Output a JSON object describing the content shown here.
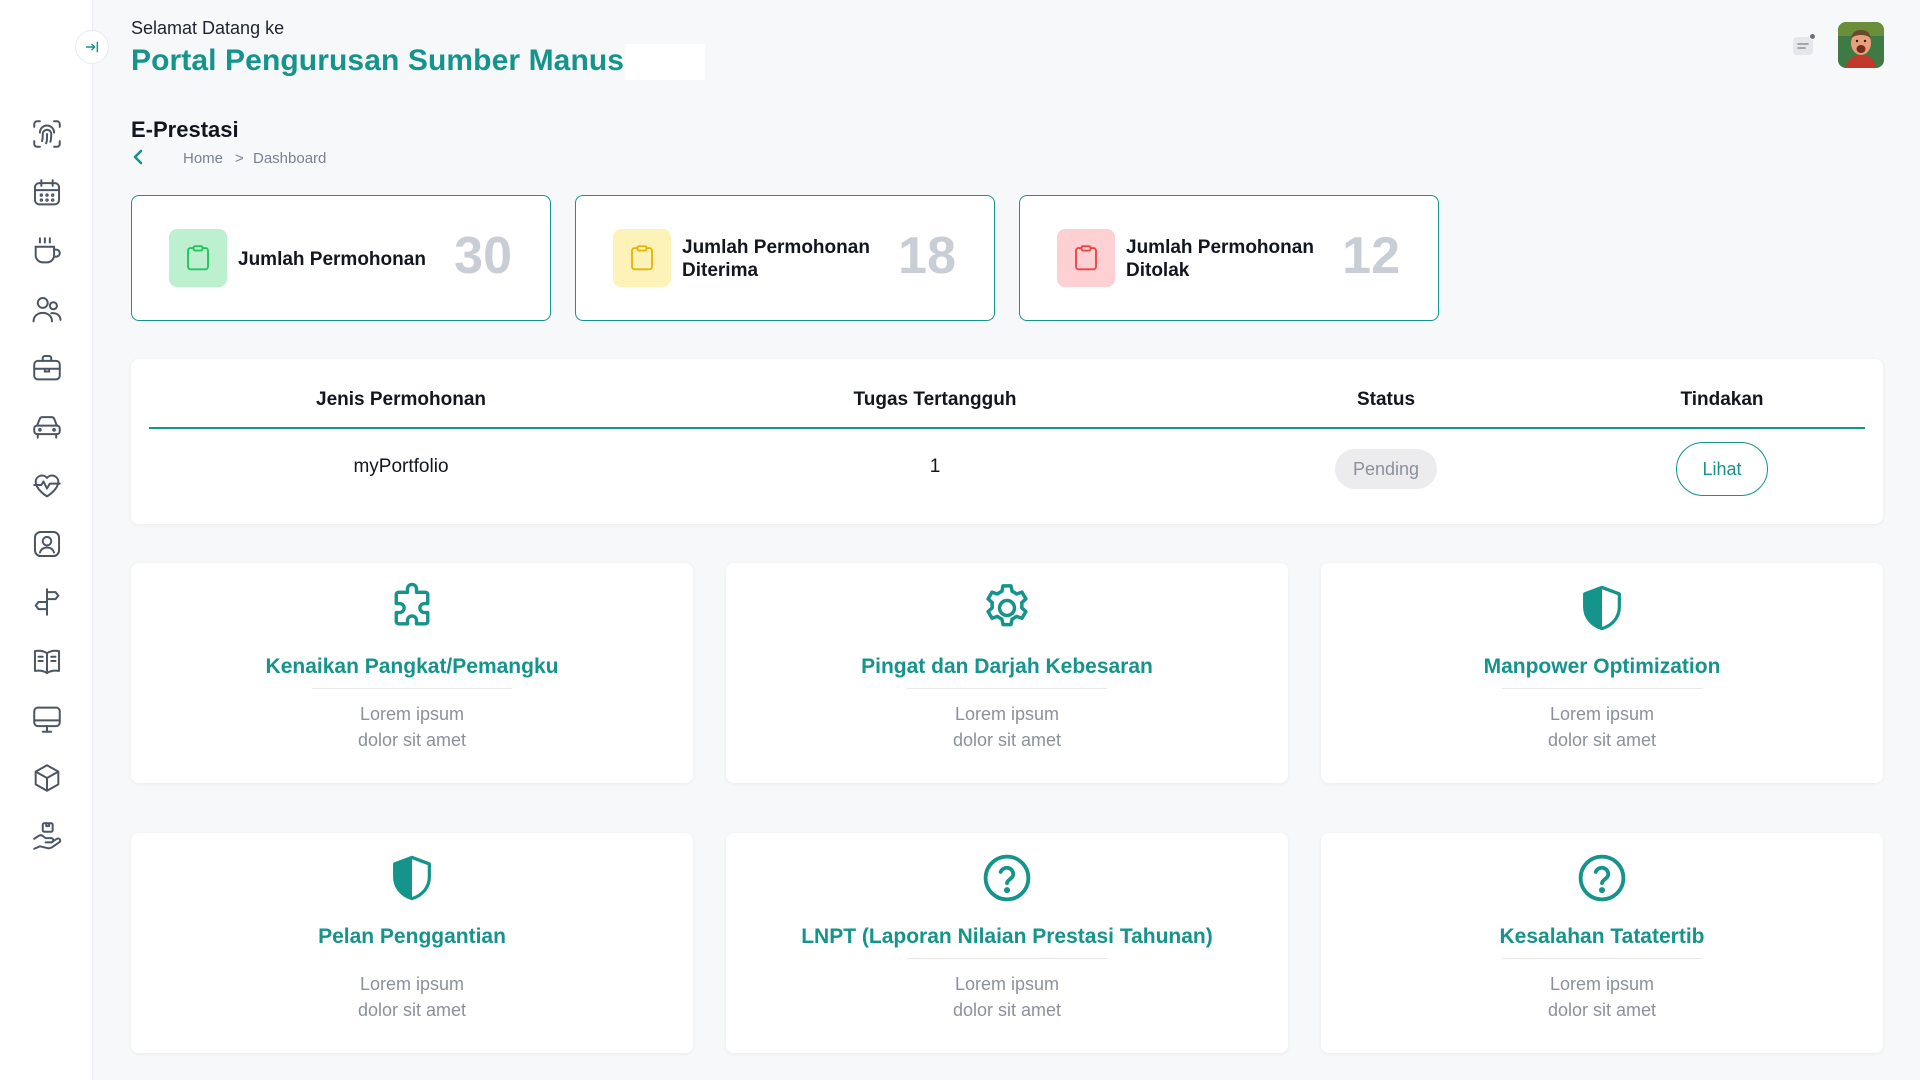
{
  "header": {
    "welcome": "Selamat Datang ke",
    "title": "Portal Pengurusan Sumber Manusia"
  },
  "sidebar": {
    "items": [
      {
        "icon": "fingerprint-icon"
      },
      {
        "icon": "calendar-icon"
      },
      {
        "icon": "coffee-cup-icon"
      },
      {
        "icon": "users-icon"
      },
      {
        "icon": "briefcase-icon"
      },
      {
        "icon": "car-icon"
      },
      {
        "icon": "heart-pulse-icon"
      },
      {
        "icon": "id-badge-icon"
      },
      {
        "icon": "signpost-icon"
      },
      {
        "icon": "open-book-icon"
      },
      {
        "icon": "monitor-icon"
      },
      {
        "icon": "cube-icon"
      },
      {
        "icon": "hand-box-icon"
      }
    ]
  },
  "page": {
    "title": "E-Prestasi",
    "breadcrumb": {
      "home": "Home",
      "separator": ">",
      "current": "Dashboard"
    }
  },
  "stats": [
    {
      "label": "Jumlah Permohonan",
      "value": "30",
      "color": "#bdf0cf",
      "icon_color": "#22c55e"
    },
    {
      "label": "Jumlah Permohonan Diterima",
      "value": "18",
      "color": "#fdf2b8",
      "icon_color": "#eab308"
    },
    {
      "label": "Jumlah Permohonan Ditolak",
      "value": "12",
      "color": "#fdd0d3",
      "icon_color": "#ef4444"
    }
  ],
  "table": {
    "headers": [
      "Jenis Permohonan",
      "Tugas Tertangguh",
      "Status",
      "Tindakan"
    ],
    "rows": [
      {
        "jenis": "myPortfolio",
        "tugas": "1",
        "status": "Pending",
        "action": "Lihat"
      }
    ]
  },
  "modules": [
    {
      "title": "Kenaikan Pangkat/Pemangku",
      "desc1": "Lorem ipsum",
      "desc2": "dolor sit amet",
      "icon": "puzzle-icon"
    },
    {
      "title": "Pingat dan Darjah Kebesaran",
      "desc1": "Lorem ipsum",
      "desc2": "dolor sit amet",
      "icon": "gear-icon"
    },
    {
      "title": "Manpower Optimization",
      "desc1": "Lorem ipsum",
      "desc2": "dolor sit amet",
      "icon": "shield-icon"
    },
    {
      "title": "Pelan Penggantian",
      "desc1": "Lorem ipsum",
      "desc2": "dolor sit amet",
      "icon": "shield-icon"
    },
    {
      "title": "LNPT (Laporan Nilaian Prestasi Tahunan)",
      "desc1": "Lorem ipsum",
      "desc2": "dolor sit amet",
      "icon": "question-circle-icon"
    },
    {
      "title": "Kesalahan Tatatertib",
      "desc1": "Lorem ipsum",
      "desc2": "dolor sit amet",
      "icon": "question-circle-icon"
    }
  ],
  "colors": {
    "accent": "#14948a"
  }
}
